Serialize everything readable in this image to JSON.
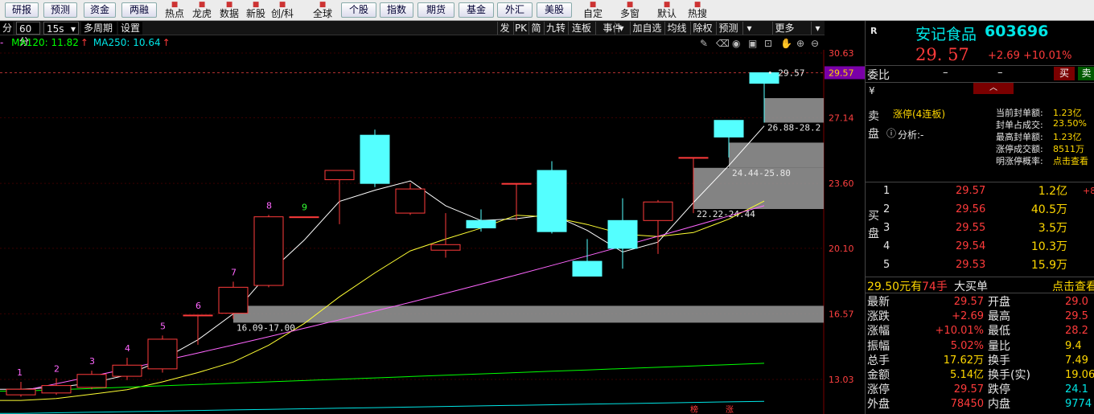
{
  "topbar": {
    "buttons": [
      "研报",
      "预测",
      "资金",
      "两融"
    ],
    "icons": [
      {
        "label": "热点",
        "icon": "fire-icon"
      },
      {
        "label": "龙虎",
        "icon": "dragon-icon"
      },
      {
        "label": "数据",
        "icon": "data-icon"
      },
      {
        "label": "新股",
        "icon": "new-stock-icon"
      },
      {
        "label": "创/科",
        "icon": "chuang-ke-icon"
      },
      {
        "label": "全球",
        "icon": "globe-icon"
      }
    ],
    "buttons2": [
      "个股",
      "指数",
      "期货",
      "基金",
      "外汇",
      "美股"
    ],
    "icons2": [
      {
        "label": "自定",
        "icon": "custom-icon"
      },
      {
        "label": "多窗",
        "icon": "multi-window-icon"
      },
      {
        "label": "默认",
        "icon": "default-icon"
      },
      {
        "label": "热搜",
        "icon": "hot-search-icon"
      }
    ]
  },
  "chartbar": {
    "period_short": "分",
    "period": "60分",
    "interval": "15s",
    "multi_period": "多周期",
    "settings": "设置",
    "right_items": [
      "发",
      "PK",
      "简",
      "九转",
      "连板",
      "事件",
      "加自选",
      "均线",
      "除权",
      "预测",
      "更多"
    ]
  },
  "ma_legend": [
    {
      "text": "MA120: 11.82",
      "color": "#00ff00"
    },
    {
      "text": "MA250: 10.64",
      "color": "#00e5e5"
    }
  ],
  "price_axis": [
    "30.63",
    "29.57",
    "27.14",
    "23.60",
    "20.10",
    "16.57",
    "13.03"
  ],
  "chart_data": {
    "type": "candlestick",
    "price_levels": [
      30.63,
      27.14,
      23.6,
      20.1,
      16.57,
      13.03
    ],
    "current_price": 29.57,
    "candles": [
      {
        "o": 12.2,
        "c": 12.5,
        "h": 12.9,
        "l": 12.1
      },
      {
        "o": 12.3,
        "c": 12.7,
        "h": 13.1,
        "l": 12.2
      },
      {
        "o": 12.6,
        "c": 13.3,
        "h": 13.5,
        "l": 12.5
      },
      {
        "o": 13.2,
        "c": 13.8,
        "h": 14.2,
        "l": 13.0
      },
      {
        "o": 13.6,
        "c": 15.2,
        "h": 15.4,
        "l": 13.4
      },
      {
        "o": 16.5,
        "c": 16.5,
        "h": 16.5,
        "l": 14.9
      },
      {
        "o": 16.6,
        "c": 18.0,
        "h": 18.3,
        "l": 16.3
      },
      {
        "o": 18.1,
        "c": 21.8,
        "h": 21.9,
        "l": 18.0
      },
      {
        "o": 21.8,
        "c": 21.8,
        "h": 21.8,
        "l": 21.8
      },
      {
        "o": 23.8,
        "c": 24.3,
        "h": 24.3,
        "l": 21.4
      },
      {
        "o": 26.2,
        "c": 23.6,
        "h": 26.5,
        "l": 23.4
      },
      {
        "o": 22.0,
        "c": 23.3,
        "h": 23.6,
        "l": 21.9
      },
      {
        "o": 20.0,
        "c": 20.3,
        "h": 22.0,
        "l": 19.6
      },
      {
        "o": 21.6,
        "c": 21.2,
        "h": 22.2,
        "l": 21.0
      },
      {
        "o": 23.6,
        "c": 23.6,
        "h": 23.6,
        "l": 21.6
      },
      {
        "o": 24.3,
        "c": 21.0,
        "h": 24.8,
        "l": 20.9
      },
      {
        "o": 19.4,
        "c": 18.6,
        "h": 20.6,
        "l": 18.6
      },
      {
        "o": 21.6,
        "c": 20.1,
        "h": 22.8,
        "l": 19.0
      },
      {
        "o": 21.6,
        "c": 22.6,
        "h": 22.7,
        "l": 19.8
      },
      {
        "o": 25.0,
        "c": 25.0,
        "h": 25.0,
        "l": 22.0
      },
      {
        "o": 27.0,
        "c": 26.1,
        "h": 27.0,
        "l": 25.0
      },
      {
        "o": 29.57,
        "c": 29.0,
        "h": 29.57,
        "l": 26.88
      }
    ],
    "counters": [
      "1",
      "2",
      "3",
      "4",
      "5",
      "6",
      "7",
      "8",
      "9"
    ],
    "gap_zones": [
      {
        "low": 16.09,
        "high": 17.0,
        "label": "16.09-17.00"
      },
      {
        "low": 22.22,
        "high": 24.44,
        "label": "22.22-24.44"
      },
      {
        "low": 24.44,
        "high": 25.8,
        "label": "24.44-25.80"
      },
      {
        "low": 26.88,
        "high": 28.2,
        "label": "26.88-28.2"
      }
    ],
    "ma_lines": [
      {
        "color": "#ffffff"
      },
      {
        "color": "#ffff33"
      },
      {
        "color": "#ff66ff"
      },
      {
        "color": "#00ff00"
      },
      {
        "color": "#00e5e5"
      }
    ],
    "bottom_marks": [
      "榜",
      "涨"
    ]
  },
  "panel": {
    "tag": "R",
    "name": "安记食品",
    "code": "603696",
    "price": "29. 57",
    "change": "+2.69",
    "change_pct": "+10.01%",
    "weibi_label": "委比",
    "weibi_value": "–",
    "weibi_value2": "–",
    "buy_btn": "买",
    "sell_btn": "卖",
    "yen": "¥",
    "sell_side": "卖盘",
    "limit_status": "涨停(4连板)",
    "analysis": "分析:-",
    "limit_info": [
      {
        "label": "当前封单额:",
        "value": "1.23亿"
      },
      {
        "label": "封单占成交:",
        "value": "23.50%"
      },
      {
        "label": "最高封单额:",
        "value": "1.23亿"
      },
      {
        "label": "涨停成交额:",
        "value": "8511万"
      },
      {
        "label": "明涨停概率:",
        "value": "点击查看"
      }
    ],
    "buy_side": "买盘",
    "bids": [
      {
        "level": "1",
        "price": "29.57",
        "vol": "1.2亿",
        "extra": "+8"
      },
      {
        "level": "2",
        "price": "29.56",
        "vol": "40.5万",
        "extra": ""
      },
      {
        "level": "3",
        "price": "29.55",
        "vol": "3.5万",
        "extra": ""
      },
      {
        "level": "4",
        "price": "29.54",
        "vol": "10.3万",
        "extra": ""
      },
      {
        "level": "5",
        "price": "29.53",
        "vol": "15.9万",
        "extra": ""
      }
    ],
    "big_order": {
      "price": "29.50元有",
      "qty": "74手",
      "label": "大买单",
      "link": "点击查看"
    },
    "stats": [
      {
        "l1": "最新",
        "v1": "29.57",
        "l2": "开盘",
        "v2": "29.0"
      },
      {
        "l1": "涨跌",
        "v1": "+2.69",
        "l2": "最高",
        "v2": "29.5"
      },
      {
        "l1": "涨幅",
        "v1": "+10.01%",
        "l2": "最低",
        "v2": "28.2"
      },
      {
        "l1": "振幅",
        "v1": "5.02%",
        "l2": "量比",
        "v2": "9.4"
      },
      {
        "l1": "总手",
        "v1": "17.62万",
        "l2": "换手",
        "v2": "7.49"
      },
      {
        "l1": "金额",
        "v1": "5.14亿",
        "l2": "换手(实)",
        "v2": "19.06"
      },
      {
        "l1": "涨停",
        "v1": "29.57",
        "l2": "跌停",
        "v2": "24.1"
      },
      {
        "l1": "外盘",
        "v1": "78450",
        "l2": "内盘",
        "v2": "9774"
      }
    ]
  }
}
